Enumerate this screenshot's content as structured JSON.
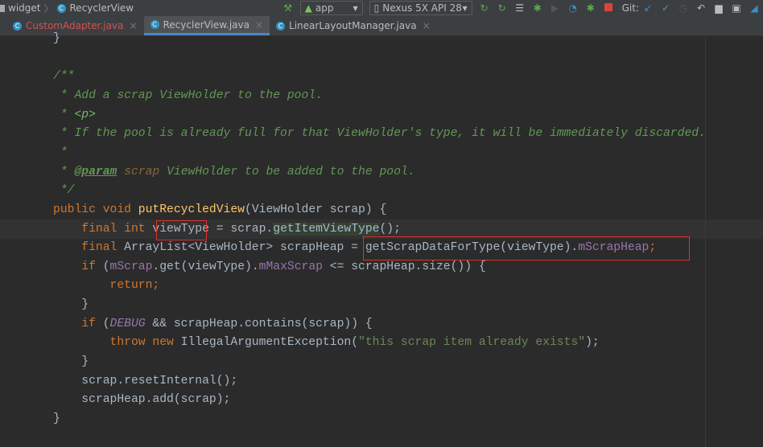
{
  "breadcrumb": {
    "items": [
      "widget",
      "RecyclerView"
    ]
  },
  "toolbar": {
    "run_config": "app",
    "device": "Nexus 5X API 28",
    "git_label": "Git:",
    "icons": [
      "hammer-icon",
      "android-icon",
      "apply-changes-icon",
      "apply-code-changes-icon",
      "logcat-icon",
      "debug-icon",
      "attach-debugger-icon",
      "profiler-icon",
      "debug-attach-icon",
      "stop-icon",
      "git-update-icon",
      "git-commit-icon",
      "git-history-icon",
      "git-revert-icon",
      "project-structure-icon",
      "terminal-icon",
      "sdk-manager-icon"
    ]
  },
  "tabs": [
    {
      "label": "CustomAdapter.java",
      "active": false,
      "modified": true
    },
    {
      "label": "RecyclerView.java",
      "active": true
    },
    {
      "label": "LinearLayoutManager.java",
      "active": false
    }
  ],
  "colors": {
    "keyword": "#cc7832",
    "method": "#ffc66d",
    "field": "#9876aa",
    "string": "#6a8759",
    "comment": "#629755",
    "text": "#a9b7c6",
    "highlight_box": "#e0302a"
  },
  "code": [
    [
      [
        "t",
        "}"
      ]
    ],
    [],
    [
      [
        "c",
        "/**"
      ]
    ],
    [
      [
        "c",
        " * Add a scrap ViewHolder to the pool."
      ]
    ],
    [
      [
        "c",
        " * "
      ],
      [
        "ct",
        "<p>"
      ]
    ],
    [
      [
        "c",
        " * If the pool is already full for that ViewHolder's type, it will be immediately discarded."
      ]
    ],
    [
      [
        "c",
        " *"
      ]
    ],
    [
      [
        "c",
        " * "
      ],
      [
        "pa",
        "@param"
      ],
      [
        "c",
        " "
      ],
      [
        "pn",
        "scrap"
      ],
      [
        "c",
        " ViewHolder to be added to the pool."
      ]
    ],
    [
      [
        "c",
        " */"
      ]
    ],
    [
      [
        "k",
        "public void "
      ],
      [
        "f",
        "putRecycledView"
      ],
      [
        "t",
        "(ViewHolder scrap) {"
      ]
    ],
    [
      [
        "k",
        "    final int "
      ],
      [
        "t",
        "viewType = scrap."
      ],
      [
        "hl",
        "getItemViewType"
      ],
      [
        "t",
        "();"
      ]
    ],
    [
      [
        "k",
        "    final "
      ],
      [
        "t",
        "ArrayList<ViewHolder> scrapHeap = getScrapDataForType(viewType)."
      ],
      [
        "p",
        "mScrapHeap"
      ],
      [
        "k",
        ";"
      ]
    ],
    [
      [
        "k",
        "    if "
      ],
      [
        "t",
        "("
      ],
      [
        "p",
        "mScrap"
      ],
      [
        "t",
        ".get(viewType)."
      ],
      [
        "p",
        "mMaxScrap"
      ],
      [
        "t",
        " <= scrapHeap.size()) {"
      ]
    ],
    [
      [
        "k",
        "        return;"
      ]
    ],
    [
      [
        "t",
        "    }"
      ]
    ],
    [
      [
        "k",
        "    if "
      ],
      [
        "t",
        "("
      ],
      [
        "d",
        "DEBUG"
      ],
      [
        "t",
        " && scrapHeap.contains(scrap)) {"
      ]
    ],
    [
      [
        "k",
        "        throw new "
      ],
      [
        "t",
        "IllegalArgumentException("
      ],
      [
        "s",
        "\"this scrap item already exists\""
      ],
      [
        "t",
        ");"
      ]
    ],
    [
      [
        "t",
        "    }"
      ]
    ],
    [
      [
        "t",
        "    scrap.resetInternal();"
      ]
    ],
    [
      [
        "t",
        "    scrapHeap.add(scrap);"
      ]
    ],
    [
      [
        "t",
        "}"
      ]
    ]
  ]
}
